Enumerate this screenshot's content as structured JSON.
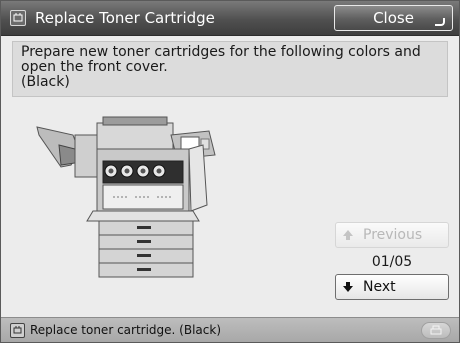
{
  "window": {
    "title": "Replace Toner Cartridge",
    "close_label": "Close"
  },
  "message": {
    "line1": "Prepare new toner cartridges for the following colors and",
    "line2": "open the front cover.",
    "line3": "(Black)"
  },
  "navigation": {
    "previous_label": "Previous",
    "next_label": "Next",
    "page_indicator": "01/05",
    "previous_enabled": false
  },
  "status_bar": {
    "text": "Replace toner cartridge. (Black)"
  },
  "icons": {
    "title": "toner-icon",
    "status": "toner-icon",
    "previous": "up-arrow-icon",
    "next": "down-arrow-icon",
    "status_button": "printer-icon"
  }
}
